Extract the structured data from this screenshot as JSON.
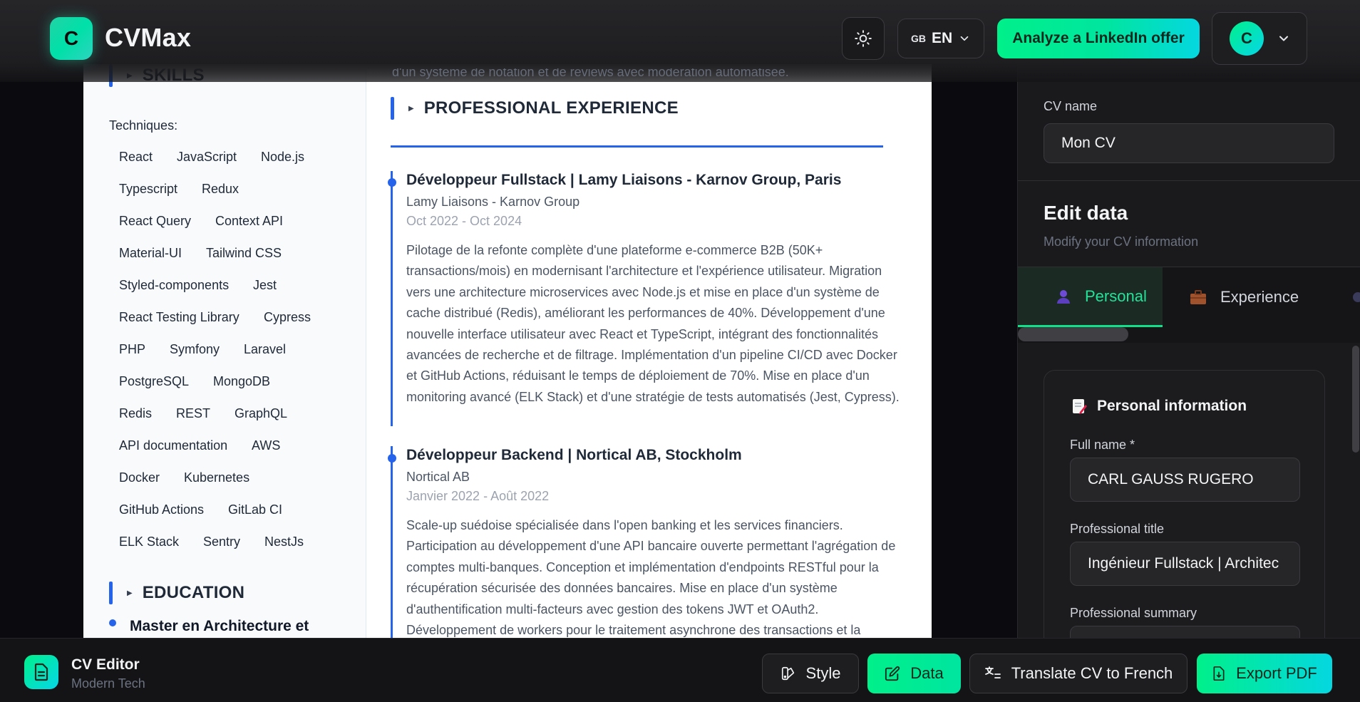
{
  "header": {
    "logo_letter": "C",
    "app_name": "CVMax",
    "lang_flag": "GB",
    "lang_code": "EN",
    "analyze_label": "Analyze a LinkedIn offer",
    "user_initial": "C"
  },
  "cv": {
    "top_cut_text": "d'un système de notation et de reviews avec modération automatisée.",
    "skills": {
      "title": "SKILLS",
      "label": "Techniques:",
      "rows": [
        [
          "React",
          "JavaScript",
          "Node.js"
        ],
        [
          "Typescript",
          "Redux"
        ],
        [
          "React Query",
          "Context API"
        ],
        [
          "Material-UI",
          "Tailwind CSS"
        ],
        [
          "Styled-components",
          "Jest"
        ],
        [
          "React Testing Library",
          "Cypress"
        ],
        [
          "PHP",
          "Symfony",
          "Laravel"
        ],
        [
          "PostgreSQL",
          "MongoDB"
        ],
        [
          "Redis",
          "REST",
          "GraphQL"
        ],
        [
          "API documentation",
          "AWS"
        ],
        [
          "Docker",
          "Kubernetes"
        ],
        [
          "GitHub Actions",
          "GitLab CI"
        ],
        [
          "ELK Stack",
          "Sentry",
          "NestJs"
        ]
      ]
    },
    "education": {
      "title": "EDUCATION",
      "item": "Master en Architecture et"
    },
    "experience": {
      "title": "PROFESSIONAL EXPERIENCE",
      "items": [
        {
          "title": "Développeur Fullstack | Lamy Liaisons - Karnov Group, Paris",
          "company": "Lamy Liaisons - Karnov Group",
          "dates": "Oct 2022 - Oct 2024",
          "desc": "Pilotage de la refonte complète d'une plateforme e-commerce B2B (50K+ transactions/mois) en modernisant l'architecture et l'expérience utilisateur. Migration vers une architecture microservices avec Node.js et mise en place d'un système de cache distribué (Redis), améliorant les performances de 40%. Développement d'une nouvelle interface utilisateur avec React et TypeScript, intégrant des fonctionnalités avancées de recherche et de filtrage. Implémentation d'un pipeline CI/CD avec Docker et GitHub Actions, réduisant le temps de déploiement de 70%. Mise en place d'un monitoring avancé (ELK Stack) et d'une stratégie de tests automatisés (Jest, Cypress)."
        },
        {
          "title": "Développeur Backend | Nortical AB, Stockholm",
          "company": "Nortical AB",
          "dates": "Janvier 2022 - Août 2022",
          "desc": "Scale-up suédoise spécialisée dans l'open banking et les services financiers. Participation au développement d'une API bancaire ouverte permettant l'agrégation de comptes multi-banques. Conception et implémentation d'endpoints RESTful pour la récupération sécurisée des données bancaires. Mise en place d'un système d'authentification multi-facteurs avec gestion des tokens JWT et OAuth2. Développement de workers pour le traitement asynchrone des transactions et la"
        }
      ]
    }
  },
  "panel": {
    "cv_name_label": "CV name",
    "cv_name_value": "Mon CV",
    "edit_title": "Edit data",
    "edit_sub": "Modify your CV information",
    "tabs": [
      {
        "label": "Personal",
        "icon": "person-icon"
      },
      {
        "label": "Experience",
        "icon": "briefcase-icon"
      }
    ],
    "card_title": "Personal information",
    "fields": {
      "full_name_label": "Full name *",
      "full_name_value": "CARL GAUSS RUGERO",
      "title_label": "Professional title",
      "title_value": "Ingénieur Fullstack | Architec",
      "summary_label": "Professional summary"
    }
  },
  "bottom": {
    "editor_title": "CV Editor",
    "editor_sub": "Modern Tech",
    "style_label": "Style",
    "data_label": "Data",
    "translate_label": "Translate CV to French",
    "export_label": "Export PDF"
  },
  "colors": {
    "accent": "#00f08a",
    "accent2": "#05d7e0",
    "cv_blue": "#2563eb"
  }
}
